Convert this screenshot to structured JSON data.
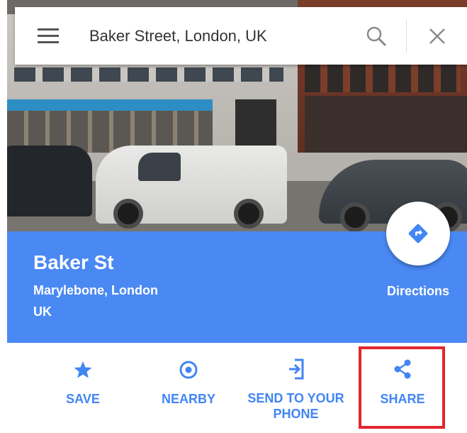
{
  "search": {
    "query": "Baker Street, London, UK"
  },
  "place": {
    "title": "Baker St",
    "subtitle_line1": "Marylebone, London",
    "subtitle_line2": "UK"
  },
  "directions": {
    "label": "Directions"
  },
  "actions": [
    {
      "label": "SAVE",
      "icon": "star-icon"
    },
    {
      "label": "NEARBY",
      "icon": "location-pin-icon"
    },
    {
      "label_line1": "SEND TO YOUR",
      "label_line2": "PHONE",
      "icon": "send-to-phone-icon"
    },
    {
      "label": "SHARE",
      "icon": "share-icon"
    }
  ],
  "colors": {
    "accent_blue": "#4285f4",
    "panel_blue": "#4a89f3",
    "highlight_red": "#e1262d"
  }
}
